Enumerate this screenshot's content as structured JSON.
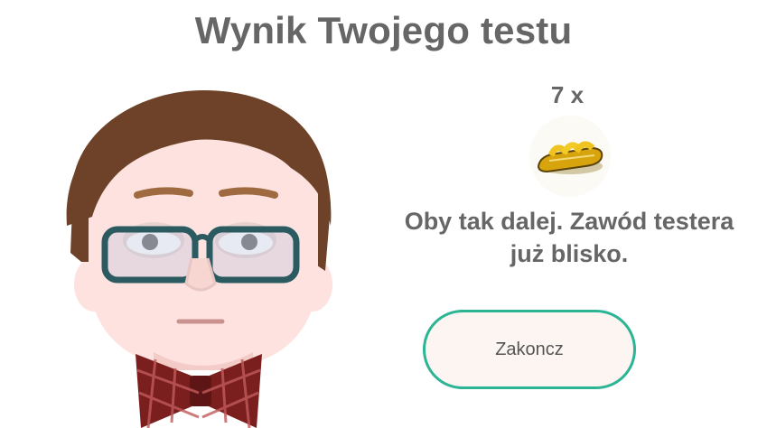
{
  "result": {
    "title": "Wynik Twojego testu",
    "count_label": "7 x",
    "message": "Oby tak dalej. Zawód testera już blisko.",
    "finish_button_label": "Zakoncz"
  },
  "icons": {
    "reward": "sandal-icon",
    "character": "tester-avatar"
  },
  "colors": {
    "title_text": "#666666",
    "button_border": "#2bb594",
    "button_fill": "#fcf5f2",
    "hair": "#6e4228",
    "glasses": "#2b5a60",
    "bowtie": "#7a1e1e",
    "sandal": "#e8b412"
  }
}
